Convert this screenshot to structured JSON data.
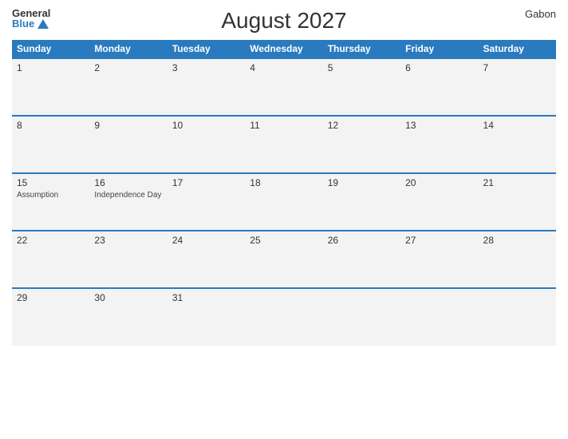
{
  "logo": {
    "general": "General",
    "blue": "Blue"
  },
  "title": "August 2027",
  "country": "Gabon",
  "days_of_week": [
    "Sunday",
    "Monday",
    "Tuesday",
    "Wednesday",
    "Thursday",
    "Friday",
    "Saturday"
  ],
  "weeks": [
    [
      {
        "day": "1",
        "event": ""
      },
      {
        "day": "2",
        "event": ""
      },
      {
        "day": "3",
        "event": ""
      },
      {
        "day": "4",
        "event": ""
      },
      {
        "day": "5",
        "event": ""
      },
      {
        "day": "6",
        "event": ""
      },
      {
        "day": "7",
        "event": ""
      }
    ],
    [
      {
        "day": "8",
        "event": ""
      },
      {
        "day": "9",
        "event": ""
      },
      {
        "day": "10",
        "event": ""
      },
      {
        "day": "11",
        "event": ""
      },
      {
        "day": "12",
        "event": ""
      },
      {
        "day": "13",
        "event": ""
      },
      {
        "day": "14",
        "event": ""
      }
    ],
    [
      {
        "day": "15",
        "event": "Assumption"
      },
      {
        "day": "16",
        "event": "Independence Day"
      },
      {
        "day": "17",
        "event": ""
      },
      {
        "day": "18",
        "event": ""
      },
      {
        "day": "19",
        "event": ""
      },
      {
        "day": "20",
        "event": ""
      },
      {
        "day": "21",
        "event": ""
      }
    ],
    [
      {
        "day": "22",
        "event": ""
      },
      {
        "day": "23",
        "event": ""
      },
      {
        "day": "24",
        "event": ""
      },
      {
        "day": "25",
        "event": ""
      },
      {
        "day": "26",
        "event": ""
      },
      {
        "day": "27",
        "event": ""
      },
      {
        "day": "28",
        "event": ""
      }
    ],
    [
      {
        "day": "29",
        "event": ""
      },
      {
        "day": "30",
        "event": ""
      },
      {
        "day": "31",
        "event": ""
      },
      {
        "day": "",
        "event": ""
      },
      {
        "day": "",
        "event": ""
      },
      {
        "day": "",
        "event": ""
      },
      {
        "day": "",
        "event": ""
      }
    ]
  ]
}
